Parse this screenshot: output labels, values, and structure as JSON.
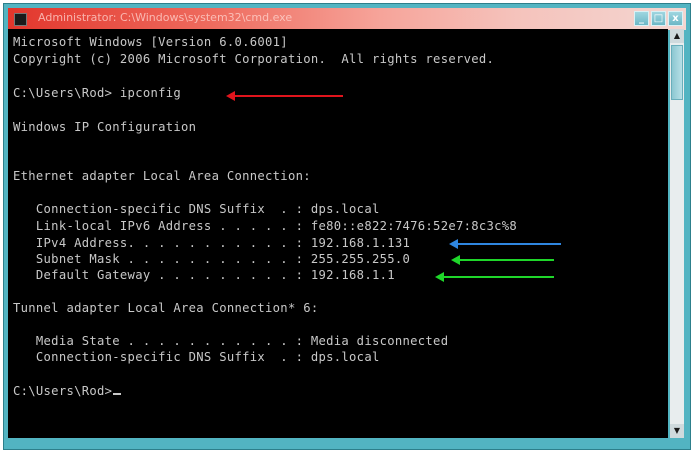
{
  "window": {
    "title": "Administrator: C:\\Windows\\system32\\cmd.exe",
    "controls": {
      "minimize": "_",
      "maximize": "□",
      "close": "x"
    }
  },
  "console": {
    "lines": [
      "Microsoft Windows [Version 6.0.6001]",
      "Copyright (c) 2006 Microsoft Corporation.  All rights reserved.",
      "",
      "C:\\Users\\Rod> ipconfig",
      "",
      "Windows IP Configuration",
      "",
      "",
      "Ethernet adapter Local Area Connection:",
      "",
      "   Connection-specific DNS Suffix  . : dps.local",
      "   Link-local IPv6 Address . . . . . : fe80::e822:7476:52e7:8c3c%8",
      "   IPv4 Address. . . . . . . . . . . : 192.168.1.131",
      "   Subnet Mask . . . . . . . . . . . : 255.255.255.0",
      "   Default Gateway . . . . . . . . . : 192.168.1.1",
      "",
      "Tunnel adapter Local Area Connection* 6:",
      "",
      "   Media State . . . . . . . . . . . : Media disconnected",
      "   Connection-specific DNS Suffix  . : dps.local",
      "",
      "C:\\Users\\Rod>"
    ]
  },
  "colors": {
    "background": "#000000",
    "text": "#c8c8c8",
    "arrow_ipconfig": "#e0141c",
    "arrow_ipv4": "#2f86e0",
    "arrow_subnet": "#1fd62a",
    "arrow_gateway": "#1fd62a",
    "title_bar": "#e2362c",
    "frame": "#52b4c2"
  },
  "icons": {
    "app": "cmd-icon",
    "minimize": "minimize-icon",
    "maximize": "maximize-icon",
    "close": "close-icon"
  }
}
